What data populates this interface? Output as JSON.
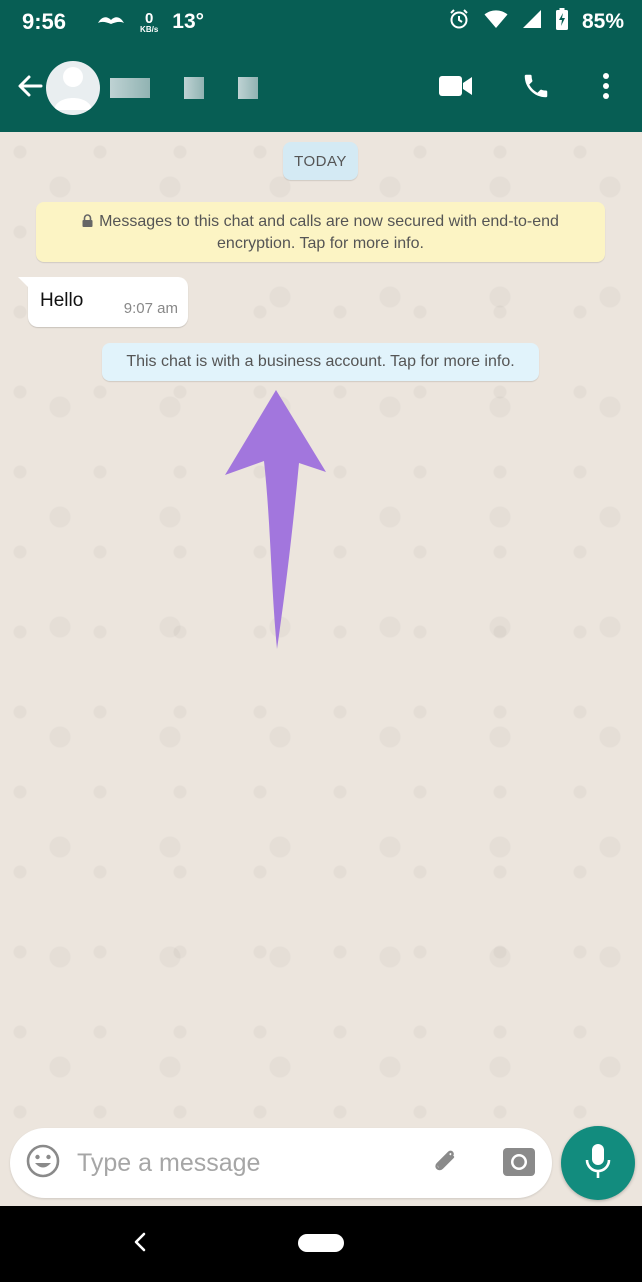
{
  "status_bar": {
    "time": "9:56",
    "network_speed_value": "0",
    "network_speed_unit": "KB/s",
    "temperature": "13°",
    "battery_percent": "85%"
  },
  "app_bar": {
    "icons": [
      "back-arrow-icon",
      "avatar-icon",
      "video-call-icon",
      "phone-icon",
      "more-vert-icon"
    ]
  },
  "chat": {
    "date_chip": "TODAY",
    "encryption_notice": "Messages to this chat and calls are now secured with end-to-end encryption. Tap for more info.",
    "messages": [
      {
        "text": "Hello",
        "time": "9:07 am"
      }
    ],
    "business_notice": "This chat is with a business account. Tap for more info."
  },
  "annotation": {
    "arrow_color": "#a276dd"
  },
  "composer": {
    "placeholder": "Type a message"
  },
  "colors": {
    "primary": "#075e54",
    "accent": "#128c7e",
    "chat_background": "#ece5dd",
    "encryption_notice_bg": "#fcf4c4",
    "system_notice_bg": "#e1f3fb"
  }
}
